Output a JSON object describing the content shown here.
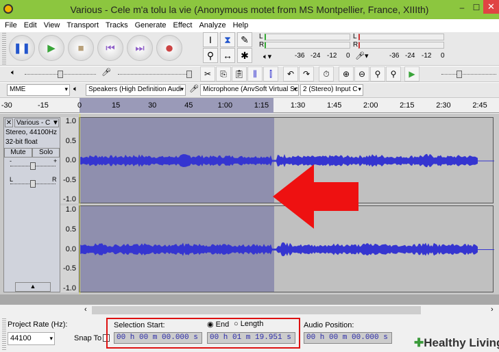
{
  "window": {
    "title": "Various - Cele m'a tolu la vie (Anonymous motet from MS Montpellier, France, XIIIth)",
    "minimize": "–",
    "maximize": "☐",
    "close": "✕"
  },
  "menu": [
    "File",
    "Edit",
    "View",
    "Transport",
    "Tracks",
    "Generate",
    "Effect",
    "Analyze",
    "Help"
  ],
  "transport": {
    "pause": "❚❚",
    "play": "▶",
    "stop": "■",
    "skip_start": "⏮",
    "skip_end": "⏭",
    "record": "●"
  },
  "meters": {
    "L": "L",
    "R": "R",
    "scale": [
      "-36",
      "-24",
      "-12",
      "0"
    ]
  },
  "devices": {
    "host": "MME",
    "output": "Speakers (High Definition Audi",
    "input": "Microphone (AnvSoft Virtual Sc",
    "channels": "2 (Stereo) Input C"
  },
  "ruler": [
    {
      "t": -30,
      "l": "-30"
    },
    {
      "t": -15,
      "l": "-15"
    },
    {
      "t": 0,
      "l": "0"
    },
    {
      "t": 15,
      "l": "15"
    },
    {
      "t": 30,
      "l": "30"
    },
    {
      "t": 45,
      "l": "45"
    },
    {
      "t": 60,
      "l": "1:00"
    },
    {
      "t": 75,
      "l": "1:15"
    },
    {
      "t": 90,
      "l": "1:30"
    },
    {
      "t": 105,
      "l": "1:45"
    },
    {
      "t": 120,
      "l": "2:00"
    },
    {
      "t": 135,
      "l": "2:15"
    },
    {
      "t": 150,
      "l": "2:30"
    },
    {
      "t": 165,
      "l": "2:45"
    }
  ],
  "track": {
    "name": "Various - C",
    "info1": "Stereo, 44100Hz",
    "info2": "32-bit float",
    "mute": "Mute",
    "solo": "Solo",
    "gain_minus": "-",
    "gain_plus": "+",
    "pan_l": "L",
    "pan_r": "R",
    "axis": [
      "1.0",
      "0.5",
      "0.0",
      "-0.5",
      "-1.0"
    ]
  },
  "selection": {
    "start_sec": 0,
    "end_sec": 79.951
  },
  "bottom": {
    "project_rate_label": "Project Rate (Hz):",
    "project_rate": "44100",
    "snap_to": "Snap To",
    "selection_start_label": "Selection Start:",
    "end_label": "End",
    "length_label": "Length",
    "start_value": "00 h 00 m 00.000 s",
    "end_value": "00 h 01 m 19.951 s",
    "audio_position_label": "Audio Position:",
    "audio_position": "00 h 00 m 00.000 s"
  },
  "watermark": "Healthy Living",
  "colors": {
    "titlebar": "#8cc63f",
    "selection": "#8f8fae",
    "wave": "#3535d0",
    "arrow": "#ee1111",
    "highlight_box": "#dd1111"
  }
}
